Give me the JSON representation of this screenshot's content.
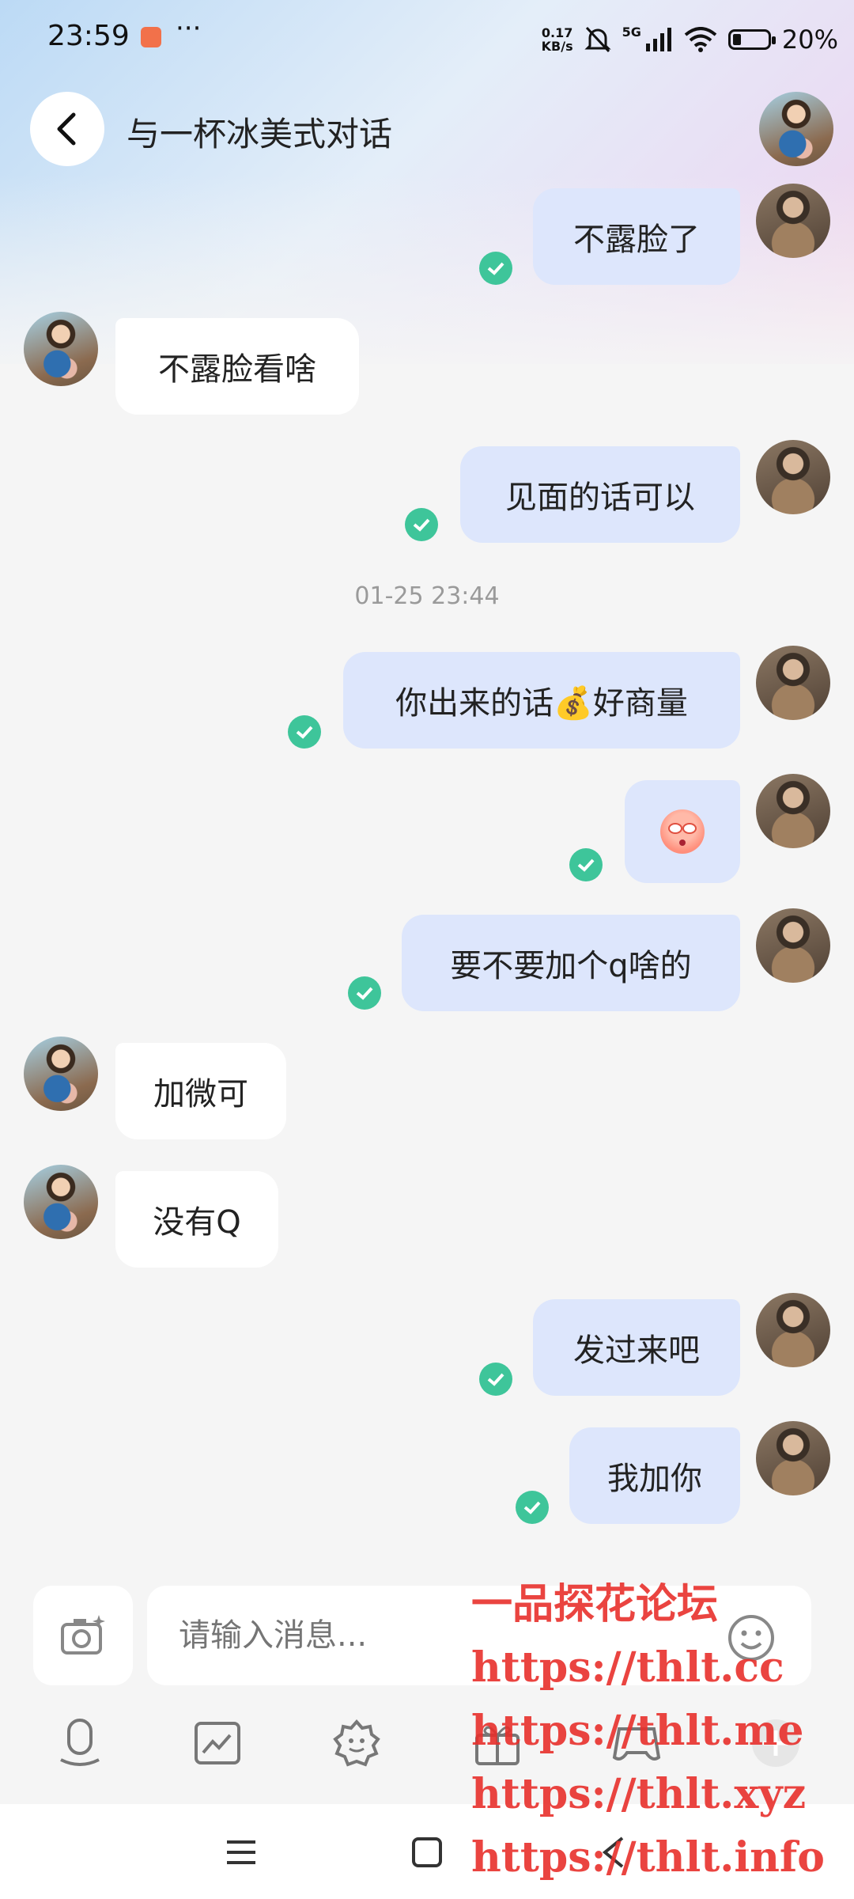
{
  "status_bar": {
    "time": "23:59",
    "more": "···",
    "net_speed_top": "0.17",
    "net_speed_bottom": "KB/s",
    "network": "5G",
    "battery": "20%"
  },
  "header": {
    "title": "与一杯冰美式对话"
  },
  "messages": [
    {
      "side": "me",
      "text": "不露脸了"
    },
    {
      "side": "other",
      "text": "不露脸看啥"
    },
    {
      "side": "me",
      "text": "见面的话可以"
    },
    {
      "side": "me",
      "text": "你出来的话💰好商量"
    },
    {
      "side": "me",
      "text": "",
      "emoji": "blushing-face-sticker"
    },
    {
      "side": "me",
      "text": "要不要加个q啥的"
    },
    {
      "side": "other",
      "text": "加微可"
    },
    {
      "side": "other",
      "text": "没有Q"
    },
    {
      "side": "me",
      "text": "发过来吧"
    },
    {
      "side": "me",
      "text": "我加你"
    }
  ],
  "timestamp": "01-25 23:44",
  "composer": {
    "placeholder": "请输入消息..."
  },
  "watermark": {
    "line1": "一品探花论坛",
    "line2": "https://thlt.cc",
    "line3": "https://thlt.me",
    "line4": "https://thlt.xyz",
    "line5": "https://thlt.info"
  },
  "colors": {
    "bubble_me": "#dde6fc",
    "bubble_other": "#ffffff",
    "read_check": "#3ec59a",
    "watermark": "#e8302c"
  },
  "icons": [
    "back-icon",
    "camera-icon",
    "emoji-icon",
    "mic-icon",
    "image-icon",
    "sticker-icon",
    "gift-icon",
    "game-icon",
    "plus-icon",
    "menu-icon",
    "home-icon",
    "back-nav-icon",
    "read-check-icon"
  ]
}
